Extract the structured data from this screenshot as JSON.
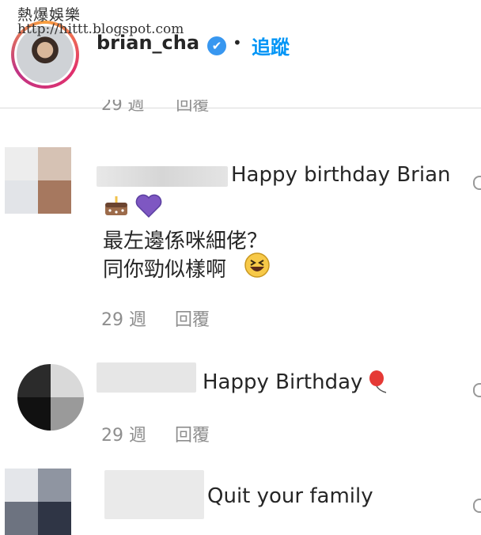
{
  "watermark": {
    "line1": "熱爆娛樂",
    "line2": "http://hittt.blogspot.com"
  },
  "header": {
    "username": "brian_cha",
    "verified": "✔",
    "separator": "•",
    "follow_label": "追蹤"
  },
  "partial_meta": {
    "time": "29 週",
    "reply": "回覆"
  },
  "comments": [
    {
      "text": "Happy birthday Brian",
      "line2": "最左邊係咪細佬？",
      "line3": "同你勁似樣啊",
      "time": "29 週",
      "reply": "回覆",
      "emoji": [
        "birthday-cake",
        "purple-heart",
        "grinning-squinting-face"
      ]
    },
    {
      "text": "Happy Birthday",
      "time": "29 週",
      "reply": "回覆",
      "emoji": [
        "balloon"
      ]
    },
    {
      "text": "Quit your family"
    }
  ],
  "colors": {
    "accent": "#0095f6",
    "verified": "#3897f0",
    "meta": "#8e8e8e",
    "heart": "#7e57c2"
  }
}
